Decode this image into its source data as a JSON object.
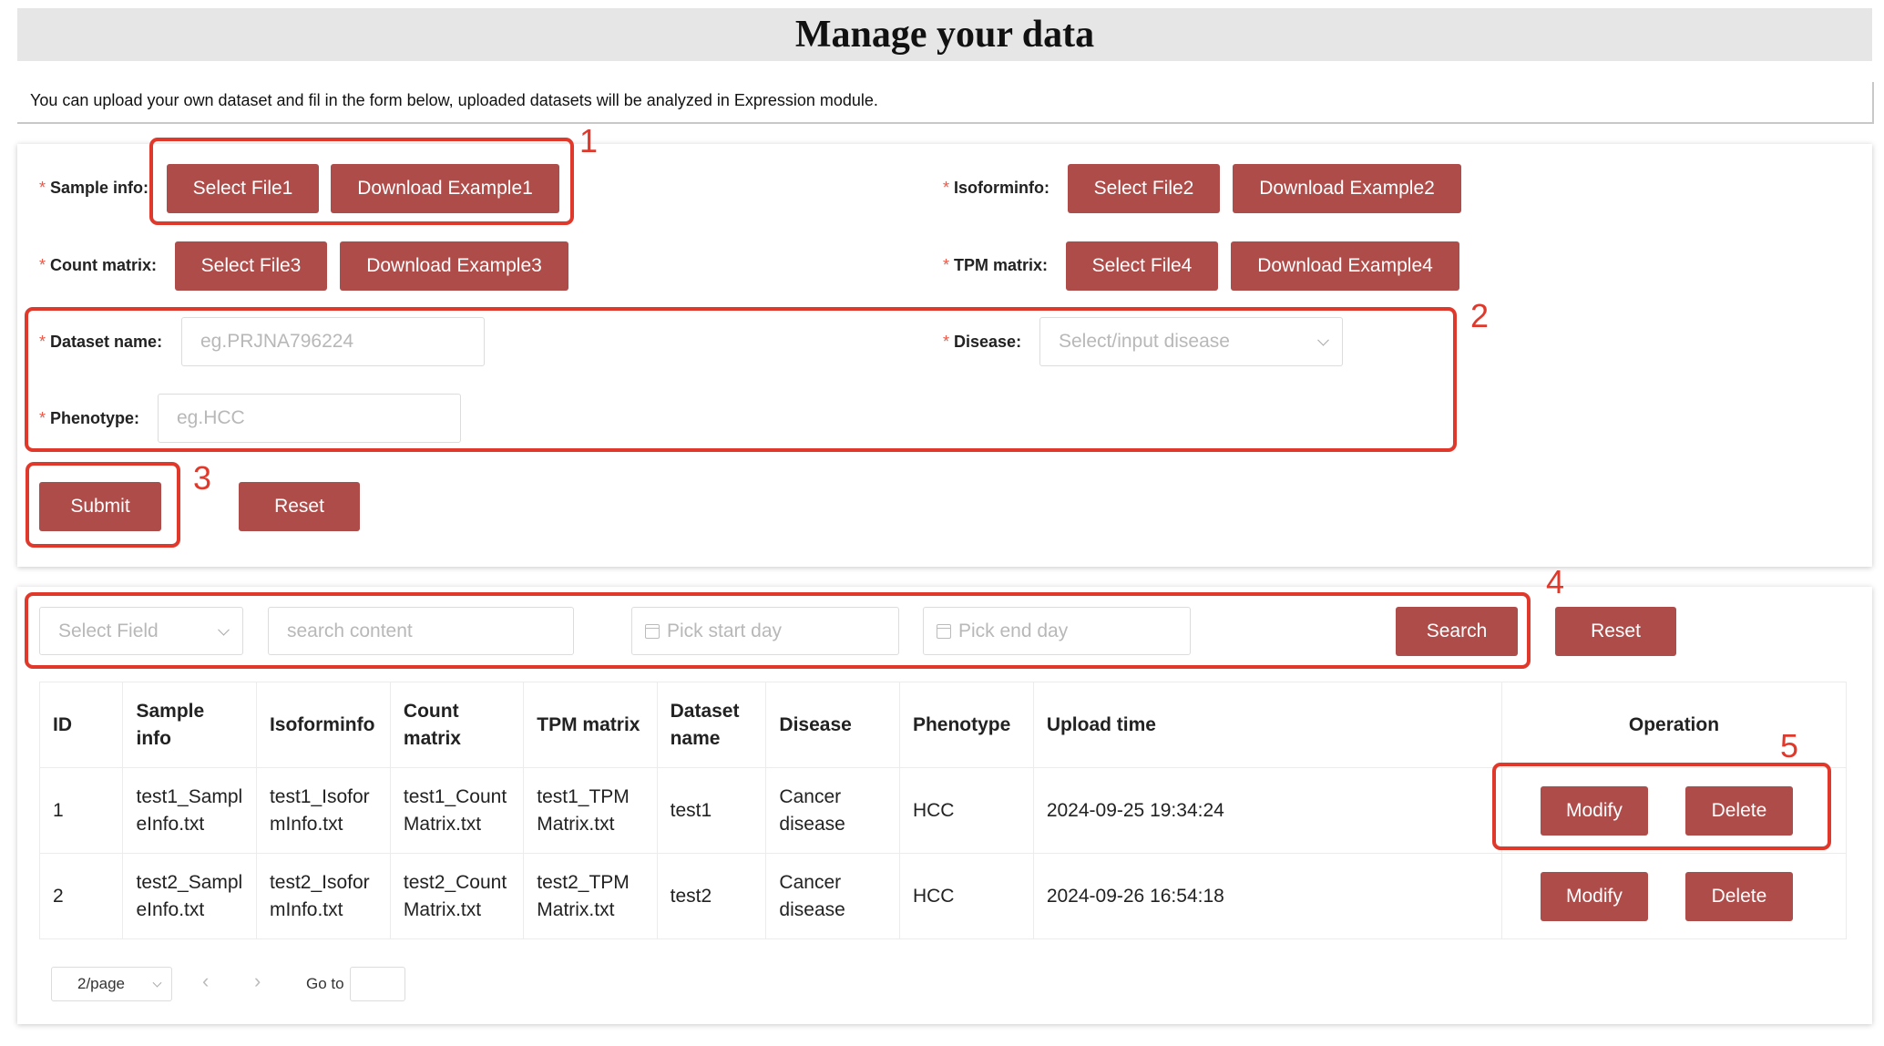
{
  "page": {
    "title": "Manage your data",
    "intro": "You can upload your own dataset and fil in the form below, uploaded datasets will be analyzed in Expression module."
  },
  "form": {
    "required_mark": "*",
    "sample_info": {
      "label": "Sample info:",
      "select": "Select File1",
      "download": "Download Example1"
    },
    "isoforminfo": {
      "label": "Isoforminfo:",
      "select": "Select File2",
      "download": "Download Example2"
    },
    "count_matrix": {
      "label": "Count matrix:",
      "select": "Select File3",
      "download": "Download Example3"
    },
    "tpm_matrix": {
      "label": "TPM matrix:",
      "select": "Select File4",
      "download": "Download Example4"
    },
    "dataset_name": {
      "label": "Dataset name:",
      "placeholder": "eg.PRJNA796224"
    },
    "disease": {
      "label": "Disease:",
      "placeholder": "Select/input disease"
    },
    "phenotype": {
      "label": "Phenotype:",
      "placeholder": "eg.HCC"
    },
    "submit": "Submit",
    "reset": "Reset"
  },
  "search": {
    "field_placeholder": "Select Field",
    "content_placeholder": "search content",
    "start_placeholder": "Pick start day",
    "end_placeholder": "Pick end day",
    "search_button": "Search",
    "reset_button": "Reset"
  },
  "table": {
    "headers": [
      "ID",
      "Sample info",
      "Isoforminfo",
      "Count matrix",
      "TPM matrix",
      "Dataset name",
      "Disease",
      "Phenotype",
      "Upload time",
      "Operation"
    ],
    "rows": [
      {
        "id": "1",
        "sample": "test1_SampleInfo.txt",
        "isoform": "test1_IsoformInfo.txt",
        "count": "test1_CountMatrix.txt",
        "tpm": "test1_TPMMatrix.txt",
        "dataset": "test1",
        "disease": "Cancer disease",
        "phenotype": "HCC",
        "time": "2024-09-25 19:34:24"
      },
      {
        "id": "2",
        "sample": "test2_SampleInfo.txt",
        "isoform": "test2_IsoformInfo.txt",
        "count": "test2_CountMatrix.txt",
        "tpm": "test2_TPMMatrix.txt",
        "dataset": "test2",
        "disease": "Cancer disease",
        "phenotype": "HCC",
        "time": "2024-09-26 16:54:18"
      }
    ],
    "modify": "Modify",
    "delete": "Delete"
  },
  "pager": {
    "page_size": "2/page",
    "prev": "‹",
    "next": "›",
    "goto": "Go to"
  },
  "annotations": [
    "1",
    "2",
    "3",
    "4",
    "5"
  ],
  "colors": {
    "button": "#ae4c4a",
    "annotation": "#e0392b",
    "header_bg": "#e6e6e6"
  }
}
